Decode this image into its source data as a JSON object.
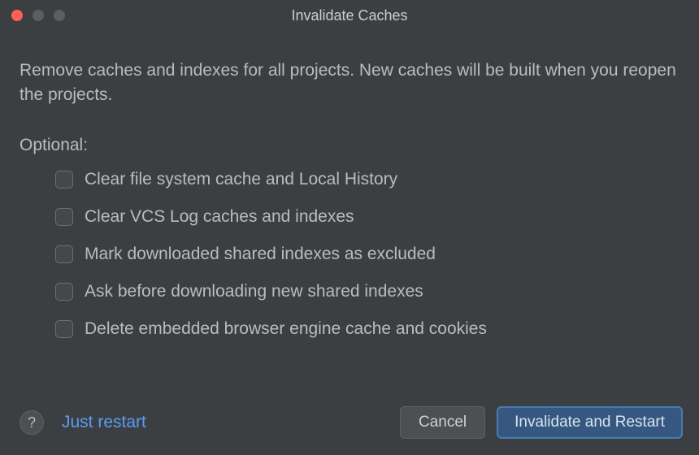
{
  "window": {
    "title": "Invalidate Caches"
  },
  "description": "Remove caches and indexes for all projects. New caches will be built when you reopen the projects.",
  "optional_label": "Optional:",
  "options": [
    {
      "label": "Clear file system cache and Local History",
      "checked": false
    },
    {
      "label": "Clear VCS Log caches and indexes",
      "checked": false
    },
    {
      "label": "Mark downloaded shared indexes as excluded",
      "checked": false
    },
    {
      "label": "Ask before downloading new shared indexes",
      "checked": false
    },
    {
      "label": "Delete embedded browser engine cache and cookies",
      "checked": false
    }
  ],
  "footer": {
    "help_label": "?",
    "just_restart": "Just restart",
    "cancel": "Cancel",
    "invalidate_and_restart": "Invalidate and Restart"
  }
}
